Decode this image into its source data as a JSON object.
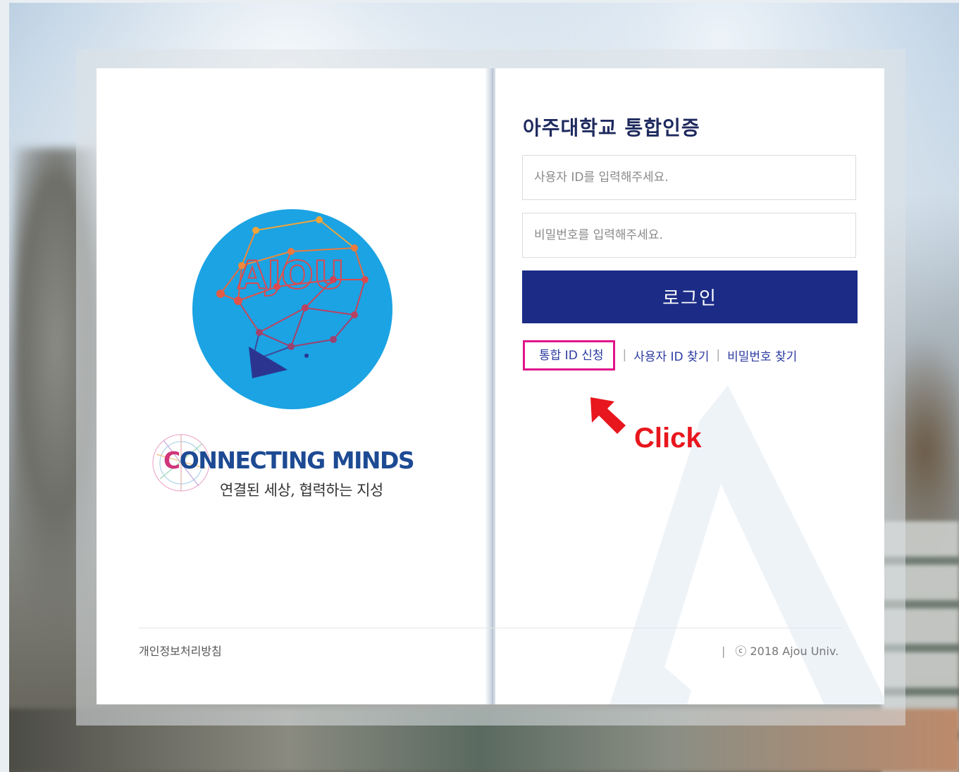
{
  "page": {
    "title": "아주대학교 통합인증"
  },
  "login": {
    "user_id_placeholder": "사용자 ID를 입력해주세요.",
    "password_placeholder": "비밀번호를 입력해주세요.",
    "submit_label": "로그인"
  },
  "links": {
    "register": "통합 ID 신청",
    "separator": "|",
    "find_user_id": "사용자 ID 찾기",
    "find_password": "비밀번호 찾기"
  },
  "annotation": {
    "click_label": "Click",
    "color": "#e8161d",
    "highlight_color": "#e0158a"
  },
  "branding": {
    "logo_text": "AJOU",
    "slogan_first_letter": "C",
    "slogan_rest": "ONNECTING MINDS",
    "slogan_sub": "연결된 세상, 협력하는 지성"
  },
  "footer": {
    "privacy": "개인정보처리방침",
    "separator": "|",
    "copyright": "ⓒ 2018 Ajou Univ."
  },
  "colors": {
    "primary": "#1b2b86",
    "title": "#1e2a5e",
    "link": "#2b3aa0",
    "logo_circle": "#1ba3e3"
  }
}
